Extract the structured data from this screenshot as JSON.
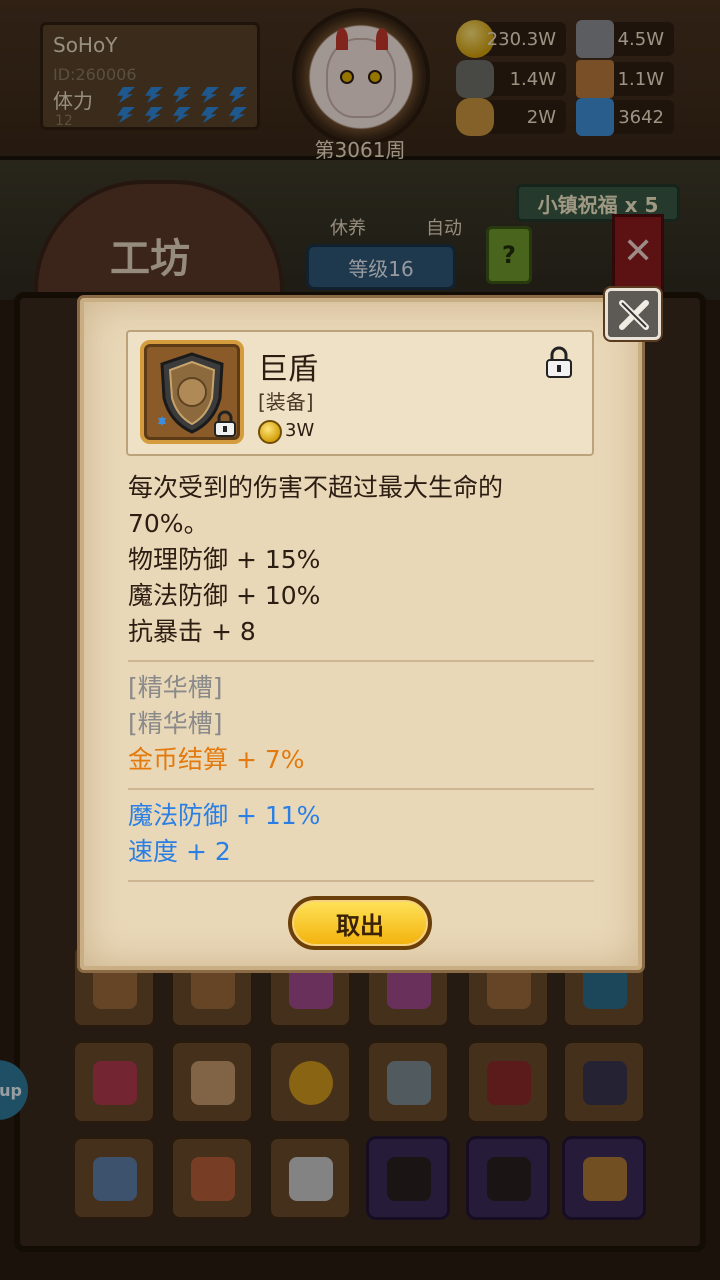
{
  "player": {
    "name": "SoHoY",
    "id": "ID:260006",
    "stamina_label": "体力",
    "stamina_value": "12"
  },
  "week": "第3061周",
  "resources": [
    {
      "icon": "gold-coin-icon",
      "value": "230.3W"
    },
    {
      "icon": "iron-ingot-icon",
      "value": "4.5W"
    },
    {
      "icon": "stone-ore-icon",
      "value": "1.4W"
    },
    {
      "icon": "leather-icon",
      "value": "1.1W"
    },
    {
      "icon": "wood-log-icon",
      "value": "2W"
    },
    {
      "icon": "crystal-icon",
      "value": "3642"
    }
  ],
  "workshop": {
    "title": "工坊",
    "rest_label": "休养",
    "auto_label": "自动",
    "level_label": "等级16",
    "help_label": "?",
    "blessing_label": "小镇祝福 x 5"
  },
  "side_tab": {
    "label": "up"
  },
  "modal": {
    "item_name": "巨盾",
    "item_type": "[装备]",
    "item_price": "3W",
    "description": "每次受到的伤害不超过最大生命的",
    "description_line2": "70%。",
    "stats": [
      "物理防御 + 15%",
      "魔法防御 + 10%",
      "抗暴击 + 8"
    ],
    "essence_slots": [
      "[精华槽]",
      "[精华槽]"
    ],
    "essence_bonus": "金币结算 + 7%",
    "extra_stats": [
      "魔法防御 + 11%",
      "速度 + 2"
    ],
    "take_out_label": "取出"
  },
  "colors": {
    "modal_bg": "#e9d8b8",
    "orange_text": "#e37a0f",
    "blue_text": "#2b7fe4",
    "muted_text": "#8a8a8a",
    "button_gold": "#f2b10c"
  }
}
